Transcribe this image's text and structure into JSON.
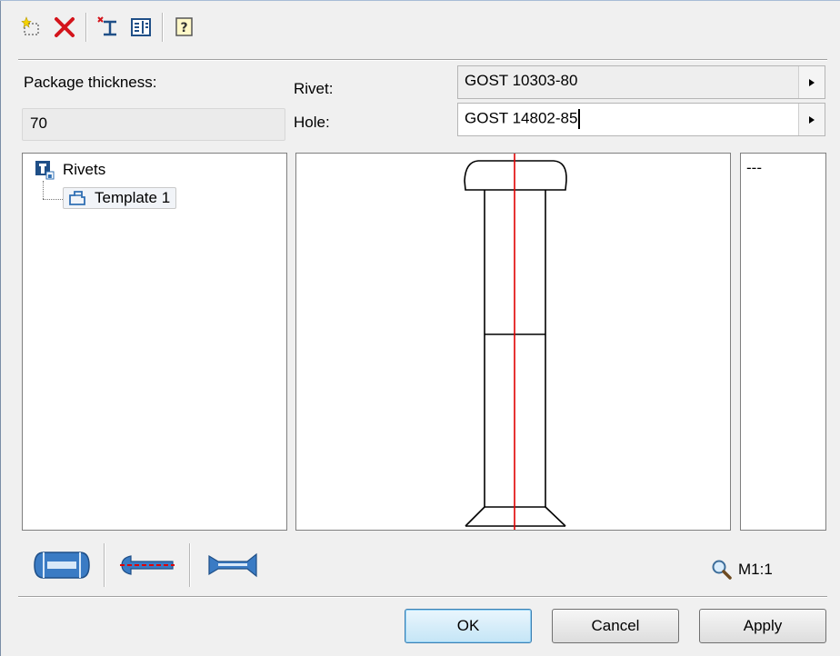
{
  "toolbar": {
    "buttons": [
      {
        "name": "new-template-icon"
      },
      {
        "name": "delete-icon"
      },
      {
        "name": "insert-rivet-icon"
      },
      {
        "name": "rivet-properties-icon"
      },
      {
        "name": "help-icon"
      }
    ]
  },
  "form": {
    "package_thickness_label": "Package thickness:",
    "package_thickness_value": "70",
    "rivet_label": "Rivet:",
    "rivet_value": "GOST 10303-80",
    "hole_label": "Hole:",
    "hole_value": "GOST 14802-85"
  },
  "tree": {
    "root_label": "Rivets",
    "child_label": "Template 1"
  },
  "properties": {
    "text": "---"
  },
  "view_tools": {
    "zoom_label": "M1:1"
  },
  "buttons": {
    "ok": "OK",
    "cancel": "Cancel",
    "apply": "Apply"
  },
  "colors": {
    "axis": "#e00000",
    "accent": "#3c7fb1",
    "icon_blue": "#2f6fb3"
  }
}
